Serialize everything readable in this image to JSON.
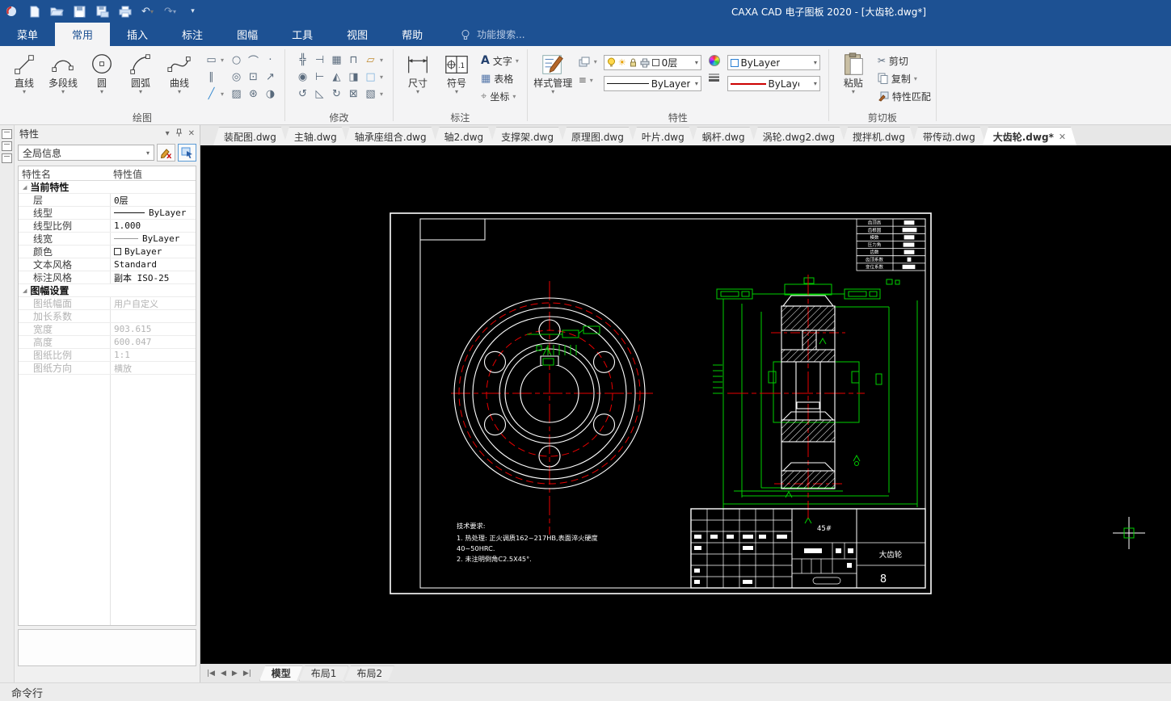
{
  "app": {
    "title": "CAXA CAD 电子图板 2020 - [大齿轮.dwg*]"
  },
  "menu": {
    "tabs": [
      "菜单",
      "常用",
      "插入",
      "标注",
      "图幅",
      "工具",
      "视图",
      "帮助"
    ],
    "search": "功能搜索..."
  },
  "ribbon": {
    "draw": {
      "label": "绘图",
      "items": [
        "直线",
        "多段线",
        "圆",
        "圆弧",
        "曲线"
      ]
    },
    "modify": {
      "label": "修改"
    },
    "annotate": {
      "label": "标注",
      "dim": "尺寸",
      "symbol": "符号",
      "text": "文字",
      "table": "表格",
      "coord": "坐标"
    },
    "properties": {
      "label": "特性",
      "style_manager": "样式管理",
      "layer": "0层",
      "color": "ByLayer",
      "linetype": "ByLayer",
      "lineweight": "ByLayer"
    },
    "clipboard": {
      "label": "剪切板",
      "paste": "粘贴",
      "cut": "剪切",
      "copy": "复制",
      "match": "特性匹配"
    }
  },
  "panel": {
    "title": "特性",
    "selector": "全局信息",
    "col_name": "特性名",
    "col_value": "特性值",
    "sec1": "当前特性",
    "rows1": [
      [
        "层",
        "0层"
      ],
      [
        "线型",
        "ByLayer"
      ],
      [
        "线型比例",
        "1.000"
      ],
      [
        "线宽",
        "ByLayer"
      ],
      [
        "颜色",
        "ByLayer"
      ],
      [
        "文本风格",
        "Standard"
      ],
      [
        "标注风格",
        "副本 ISO-25"
      ]
    ],
    "sec2": "图幅设置",
    "rows2": [
      [
        "图纸幅面",
        "用户自定义"
      ],
      [
        "加长系数",
        ""
      ],
      [
        "宽度",
        "903.615"
      ],
      [
        "高度",
        "600.047"
      ],
      [
        "图纸比例",
        "1:1"
      ],
      [
        "图纸方向",
        "横放"
      ]
    ]
  },
  "doc_tabs": [
    "装配图.dwg",
    "主轴.dwg",
    "轴承座组合.dwg",
    "轴2.dwg",
    "支撑架.dwg",
    "原理图.dwg",
    "叶片.dwg",
    "蜗杆.dwg",
    "涡轮.dwg2.dwg",
    "搅拌机.dwg",
    "带传动.dwg",
    "大齿轮.dwg*"
  ],
  "drawing": {
    "tech_requirements": [
      "技术要求:",
      "1. 热处理: 正火调质162~217HB,表面淬火硬度",
      "40~50HRC.",
      "2. 未注明倒角C2.5X45°."
    ],
    "param_rows": [
      "齿顶高",
      "齿根圆",
      "模数",
      "压力角",
      "齿数",
      "齿顶系数",
      "变位系数"
    ],
    "material": "45#",
    "part_name": "大齿轮",
    "sheet_no": "8"
  },
  "layout_tabs": [
    "模型",
    "布局1",
    "布局2"
  ],
  "status": {
    "command_line": "命令行"
  },
  "colors": {
    "titlebar_blue": "#1d5193",
    "cad_red": "#e80000",
    "cad_green": "#00d000",
    "canvas_black": "#000000"
  }
}
